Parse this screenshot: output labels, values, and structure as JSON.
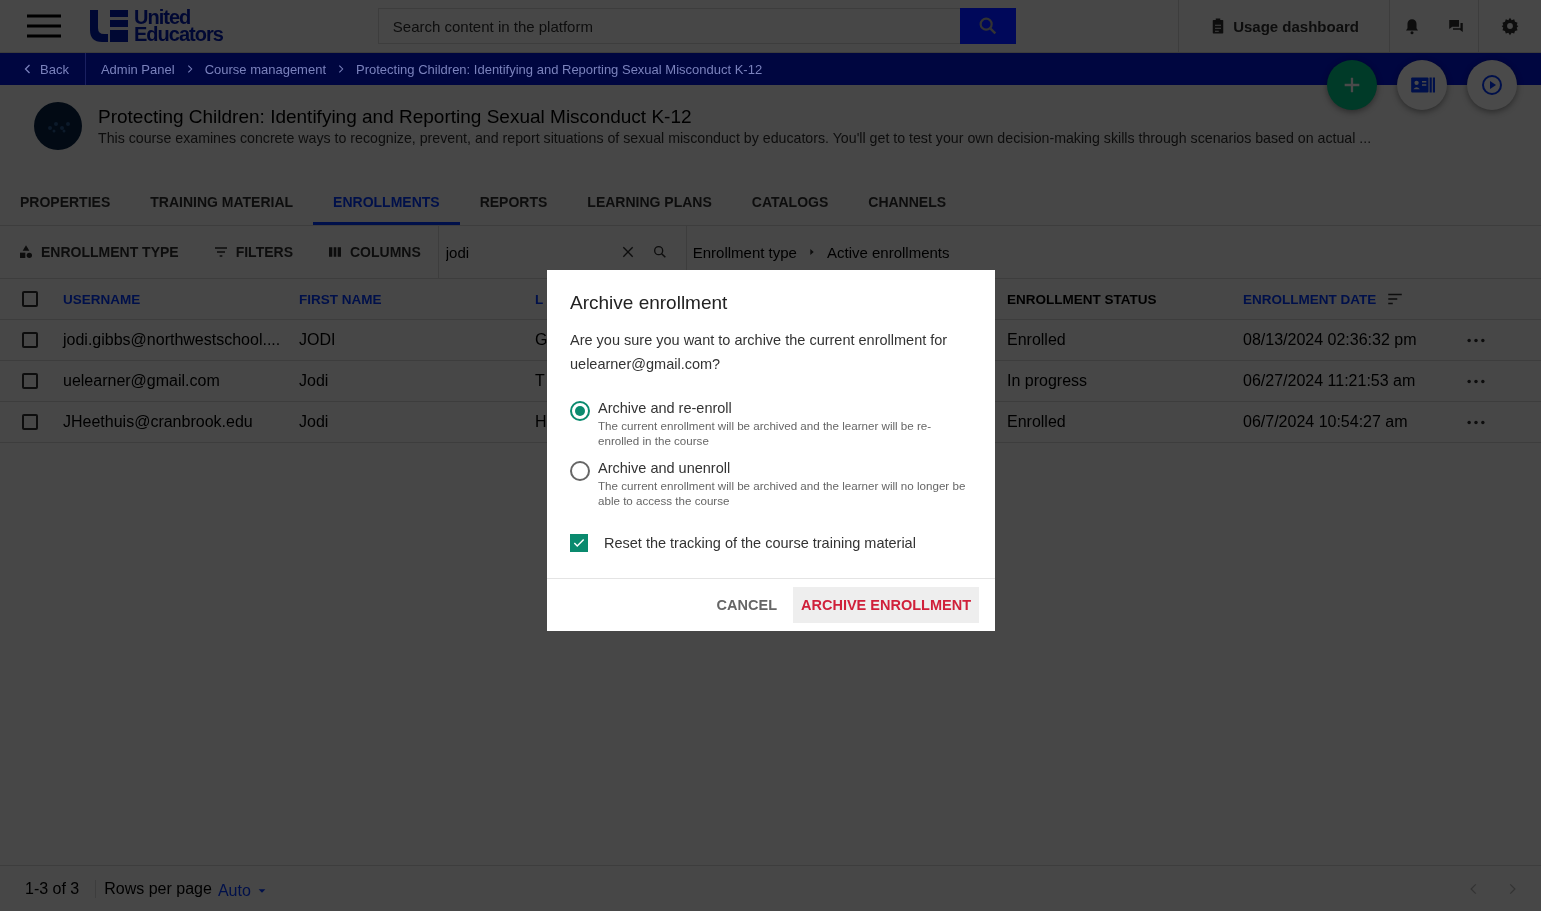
{
  "header": {
    "logo": {
      "line_1": "United",
      "line_2": "Educators"
    },
    "search": {
      "placeholder": "Search content in the platform"
    },
    "usage_dashboard": "Usage dashboard"
  },
  "breadcrumb": {
    "back": "Back",
    "items": [
      "Admin Panel",
      "Course management",
      "Protecting Children: Identifying and Reporting Sexual Misconduct K-12"
    ]
  },
  "course": {
    "title": "Protecting Children: Identifying and Reporting Sexual Misconduct K-12",
    "description": "This course examines concrete ways to recognize, prevent, and report situations of sexual misconduct by educators. You'll get to test your own decision-making skills through scenarios based on actual ..."
  },
  "tabs": [
    {
      "label": "PROPERTIES",
      "selected": false
    },
    {
      "label": "TRAINING MATERIAL",
      "selected": false
    },
    {
      "label": "ENROLLMENTS",
      "selected": true
    },
    {
      "label": "REPORTS",
      "selected": false
    },
    {
      "label": "LEARNING PLANS",
      "selected": false
    },
    {
      "label": "CATALOGS",
      "selected": false
    },
    {
      "label": "CHANNELS",
      "selected": false
    }
  ],
  "toolbar": {
    "buttons": [
      {
        "label": "ENROLLMENT TYPE",
        "kind": "type"
      },
      {
        "label": "FILTERS",
        "kind": "filter"
      },
      {
        "label": "COLUMNS",
        "kind": "columns"
      }
    ],
    "search_value": "jodi",
    "filter_path": [
      "Enrollment type",
      "Active enrollments"
    ]
  },
  "table": {
    "select_all_checked": false,
    "columns": [
      {
        "label": "USERNAME",
        "sortable": true,
        "sorted": false
      },
      {
        "label": "FIRST NAME",
        "sortable": true,
        "sorted": false
      },
      {
        "label": "L",
        "sortable": true,
        "sorted": false
      },
      {
        "label": "ENROLLMENT STATUS",
        "sortable": false,
        "sorted": false
      },
      {
        "label": "ENROLLMENT DATE",
        "sortable": true,
        "sorted": true
      }
    ],
    "rows": [
      {
        "checked": false,
        "cells": [
          "jodi.gibbs@northwestschool....",
          "JODI",
          "G",
          "Enrolled",
          "08/13/2024 02:36:32 pm"
        ]
      },
      {
        "checked": false,
        "cells": [
          "uelearner@gmail.com",
          "Jodi",
          "T",
          "In progress",
          "06/27/2024 11:21:53 am"
        ]
      },
      {
        "checked": false,
        "cells": [
          "JHeethuis@cranbrook.edu",
          "Jodi",
          "H",
          "Enrolled",
          "06/7/2024 10:54:27 am"
        ]
      }
    ]
  },
  "footer": {
    "range": "1-3 of 3",
    "rows_per_page_label": "Rows per page",
    "rows_per_page_value": "Auto"
  },
  "dialog": {
    "title": "Archive enrollment",
    "message": "Are you sure you want to archive the current enrollment for uelearner@gmail.com?",
    "options": [
      {
        "label": "Archive and re-enroll",
        "description": "The current enrollment will be archived and the learner will be re-enrolled in the course",
        "selected": true
      },
      {
        "label": "Archive and unenroll",
        "description": "The current enrollment will be archived and the learner will no longer be able to access the course",
        "selected": false
      }
    ],
    "reset_tracking": {
      "label": "Reset the tracking of the course training material",
      "checked": true
    },
    "buttons": [
      {
        "label": "CANCEL",
        "kind": "secondary"
      },
      {
        "label": "ARCHIVE ENROLLMENT",
        "kind": "danger"
      }
    ]
  }
}
